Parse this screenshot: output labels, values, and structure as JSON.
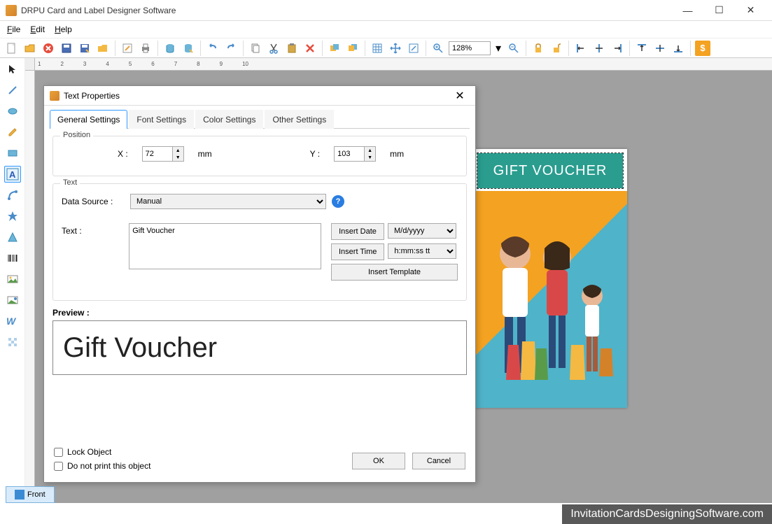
{
  "app": {
    "title": "DRPU Card and Label Designer Software"
  },
  "menu": {
    "file": "File",
    "edit": "Edit",
    "help": "Help"
  },
  "toolbar": {
    "zoom": "128%"
  },
  "canvas": {
    "banner_text": "GIFT VOUCHER"
  },
  "dialog": {
    "title": "Text Properties",
    "tabs": {
      "general": "General Settings",
      "font": "Font Settings",
      "color": "Color Settings",
      "other": "Other Settings"
    },
    "position": {
      "legend": "Position",
      "x_label": "X :",
      "x_value": "72",
      "x_unit": "mm",
      "y_label": "Y :",
      "y_value": "103",
      "y_unit": "mm"
    },
    "text_section": {
      "legend": "Text",
      "data_source_label": "Data Source :",
      "data_source_value": "Manual",
      "text_label": "Text :",
      "text_value": "Gift Voucher",
      "insert_date": "Insert Date",
      "date_format": "M/d/yyyy",
      "insert_time": "Insert Time",
      "time_format": "h:mm:ss tt",
      "insert_template": "Insert Template"
    },
    "preview_label": "Preview :",
    "preview_text": "Gift Voucher",
    "lock_label": "Lock Object",
    "noprint_label": "Do not print this object",
    "ok": "OK",
    "cancel": "Cancel"
  },
  "bottom": {
    "front": "Front"
  },
  "watermark": "InvitationCardsDesigningSoftware.com",
  "ruler": {
    "marks": [
      "1",
      "2",
      "3",
      "4",
      "5",
      "6",
      "7",
      "8",
      "9",
      "10"
    ]
  }
}
